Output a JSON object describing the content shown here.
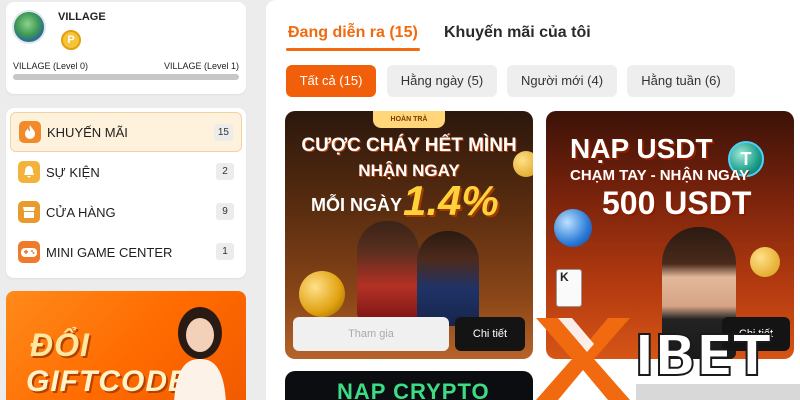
{
  "profile": {
    "name": "VILLAGE",
    "coin_symbol": "P",
    "level_current": "VILLAGE (Level 0)",
    "level_next": "VILLAGE (Level 1)",
    "level_progress": 0
  },
  "menu": {
    "items": [
      {
        "label": "KHUYẾN MÃI",
        "count": "15",
        "icon": "fire-icon"
      },
      {
        "label": "SỰ KIỆN",
        "count": "2",
        "icon": "bell-icon"
      },
      {
        "label": "CỬA HÀNG",
        "count": "9",
        "icon": "store-icon"
      },
      {
        "label": "MINI GAME CENTER",
        "count": "1",
        "icon": "gamepad-icon"
      }
    ]
  },
  "sidebar_banner": {
    "line1": "ĐỔI",
    "line2": "GIFTCODE"
  },
  "tabs": {
    "active": "Đang diễn ra (15)",
    "inactive": "Khuyến mãi của tôi"
  },
  "filters": {
    "all": "Tất cả (15)",
    "daily": "Hằng ngày (5)",
    "new": "Người mới (4)",
    "weekly": "Hằng tuần (6)"
  },
  "cards": {
    "card1": {
      "badge": "HOÀN TRẢ",
      "line1": "CƯỢC CHÁY HẾT MÌNH",
      "line2": "NHẬN NGAY",
      "line3": "MỖI NGÀY",
      "percent": "1.4%",
      "join_label": "Tham gia",
      "detail_label": "Chi tiết"
    },
    "card2": {
      "line1": "NẠP USDT",
      "line2": "CHẠM TAY - NHẬN NGAY",
      "line3": "500 USDT",
      "usdt_symbol": "T",
      "card_glyph": "K",
      "detail_label": "Chi tiết"
    },
    "card3": {
      "line1": "NẠP CRYPTO"
    }
  },
  "watermark": {
    "brand": "IBET"
  },
  "colors": {
    "accent": "#f26a0f",
    "active_filter": "#f25f0a",
    "detail_button": "#141414"
  }
}
